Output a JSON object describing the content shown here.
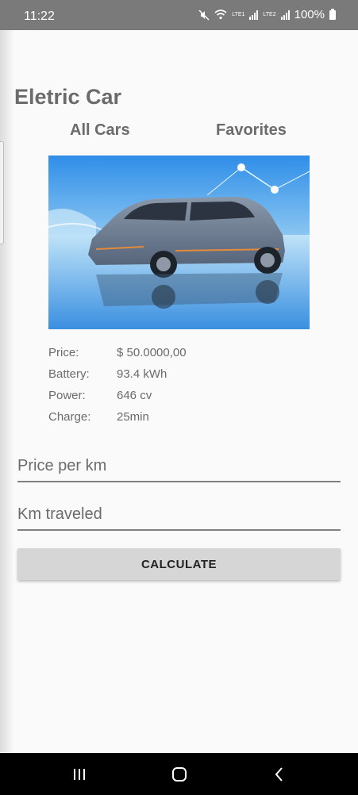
{
  "status": {
    "time": "11:22",
    "battery": "100%",
    "sim1": "LTE1",
    "sim2": "LTE2"
  },
  "app": {
    "title": "Eletric Car"
  },
  "tabs": [
    {
      "label": "All Cars"
    },
    {
      "label": "Favorites"
    }
  ],
  "car": {
    "specs": [
      {
        "label": "Price:",
        "value": "$ 50.0000,00"
      },
      {
        "label": "Battery:",
        "value": "93.4 kWh"
      },
      {
        "label": "Power:",
        "value": "646 cv"
      },
      {
        "label": "Charge:",
        "value": "25min"
      }
    ]
  },
  "form": {
    "price_placeholder": "Price per km",
    "km_placeholder": "Km traveled",
    "calculate_label": "CALCULATE"
  }
}
